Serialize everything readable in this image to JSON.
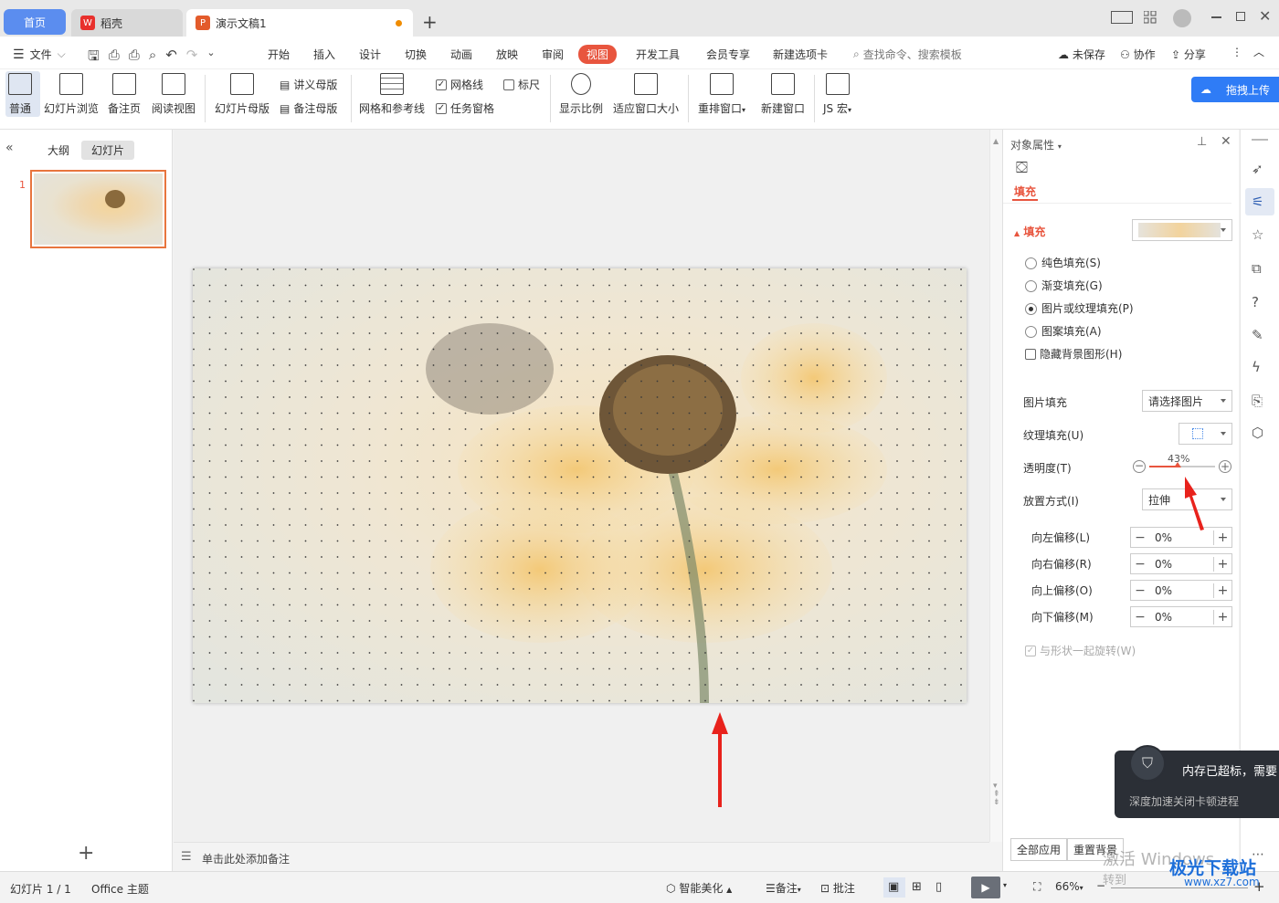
{
  "tabs": {
    "home": "首页",
    "daoke": "稻壳",
    "doc": "演示文稿1",
    "add": "+"
  },
  "menu": {
    "file": "文件",
    "items": [
      "开始",
      "插入",
      "设计",
      "切换",
      "动画",
      "放映",
      "审阅",
      "视图",
      "开发工具",
      "会员专享",
      "新建选项卡"
    ],
    "search_placeholder": "查找命令、搜索模板",
    "unsaved": "未保存",
    "collab": "协作",
    "share": "分享"
  },
  "ribbon": {
    "normal": "普通",
    "slide_browse": "幻灯片浏览",
    "notes_page": "备注页",
    "reading_view": "阅读视图",
    "slide_master": "幻灯片母版",
    "handout_master": "讲义母版",
    "notes_master": "备注母版",
    "grid_guides": "网格和参考线",
    "gridlines": "网格线",
    "ruler": "标尺",
    "task_pane": "任务窗格",
    "zoom": "显示比例",
    "fit_window": "适应窗口大小",
    "arrange": "重排窗口",
    "new_window": "新建窗口",
    "js_macro": "JS 宏",
    "upload": "拖拽上传"
  },
  "left_panel": {
    "outline_tab": "大纲",
    "slides_tab": "幻灯片",
    "slide_number": "1",
    "add": "+"
  },
  "notes": {
    "placeholder": "单击此处添加备注"
  },
  "right_pane": {
    "title": "对象属性",
    "fill_tab": "填充",
    "fill_section": "填充",
    "solid_fill": "纯色填充(S)",
    "gradient_fill": "渐变填充(G)",
    "picture_fill_option": "图片或纹理填充(P)",
    "pattern_fill": "图案填充(A)",
    "hide_bg": "隐藏背景图形(H)",
    "picture_fill_label": "图片填充",
    "picture_fill_value": "请选择图片",
    "texture_fill_label": "纹理填充(U)",
    "transparency_label": "透明度(T)",
    "transparency_value": "43%",
    "transparency_fraction": 0.43,
    "placement_label": "放置方式(I)",
    "placement_value": "拉伸",
    "offset_left_label": "向左偏移(L)",
    "offset_left_value": "0%",
    "offset_right_label": "向右偏移(R)",
    "offset_right_value": "0%",
    "offset_up_label": "向上偏移(O)",
    "offset_up_value": "0%",
    "offset_down_label": "向下偏移(M)",
    "offset_down_value": "0%",
    "rotate_with_shape": "与形状一起旋转(W)",
    "apply_all": "全部应用",
    "reset_bg": "重置背景"
  },
  "toast": {
    "title": "内存已超标，需要",
    "body": "深度加速关闭卡顿进程"
  },
  "status": {
    "slide_counter": "幻灯片 1 / 1",
    "theme": "Office 主题",
    "smart_beautify": "智能美化",
    "notes": "备注",
    "comments": "批注",
    "zoom": "66%",
    "watermark_1": "激活 Windows",
    "watermark_2": "转到",
    "site": "极光下载站",
    "site_url": "www.xz7.com"
  },
  "colors": {
    "accent": "#e8553e",
    "home_tab": "#5b8def",
    "upload_btn": "#2f7cf6",
    "arrow": "#e8221c"
  }
}
